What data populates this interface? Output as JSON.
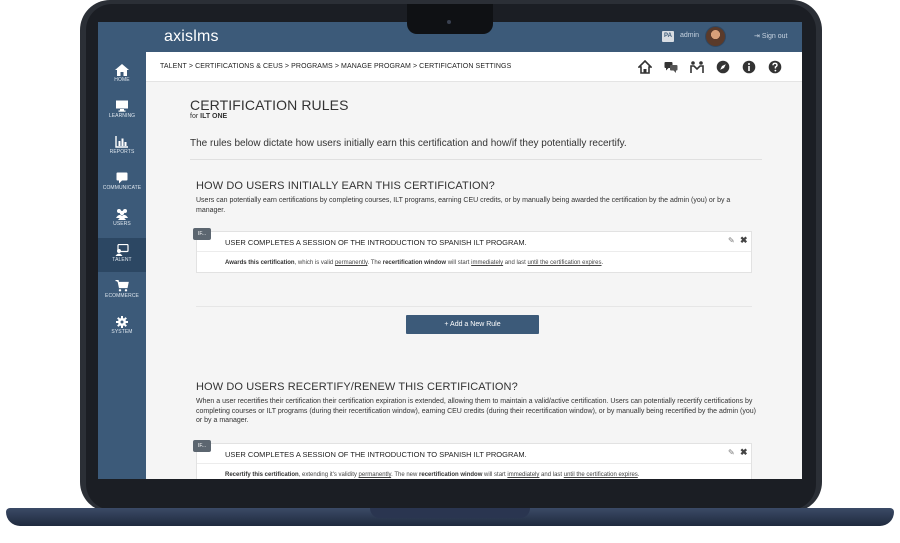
{
  "app": {
    "logo": "axislms",
    "user_badge": "PA",
    "user_name": "admin",
    "signout": "Sign out"
  },
  "breadcrumb": "TALENT  >  CERTIFICATIONS & CEUS  >  PROGRAMS  >  MANAGE PROGRAM  > CERTIFICATION SETTINGS",
  "sidebar": {
    "items": [
      {
        "label": "HOME",
        "icon": "home-icon"
      },
      {
        "label": "LEARNING",
        "icon": "monitor-icon"
      },
      {
        "label": "REPORTS",
        "icon": "chart-icon"
      },
      {
        "label": "COMMUNICATE",
        "icon": "chat-icon"
      },
      {
        "label": "USERS",
        "icon": "users-icon"
      },
      {
        "label": "TALENT",
        "icon": "talent-icon"
      },
      {
        "label": "ECOMMERCE",
        "icon": "cart-icon"
      },
      {
        "label": "SYSTEM",
        "icon": "gear-icon"
      }
    ]
  },
  "page": {
    "title": "CERTIFICATION RULES",
    "sub_prefix": "for",
    "sub_name": "ILT ONE",
    "intro": "The rules below dictate how users initially earn this certification and how/if they potentially recertify."
  },
  "earn": {
    "title": "HOW DO USERS INITIALLY EARN THIS CERTIFICATION?",
    "desc": "Users can potentially earn certifications by completing courses, ILT programs, earning CEU credits, or by manually being awarded the certification by the admin (you) or by a manager.",
    "rule": {
      "badge": "IF...",
      "head": "USER COMPLETES A SESSION OF THE INTRODUCTION TO SPANISH ILT PROGRAM.",
      "b1": "Awards this certification",
      "b2": ", which is valid ",
      "b3": "permanently",
      "b4": ". The ",
      "b5": "recertification window",
      "b6": " will start ",
      "b7": "immediately",
      "b8": " and last ",
      "b9": "until the certification expires",
      "b10": "."
    },
    "add_button": "+ Add a New Rule"
  },
  "recertify": {
    "title": "HOW DO USERS RECERTIFY/RENEW THIS CERTIFICATION?",
    "desc": "When a user recertifies their certification their certification expiration is extended, allowing them to maintain a valid/active certification. Users can potentially recertify certifications by completing courses or ILT programs (during their recertification window), earning CEU credits (during their recertification window), or by manually being recertified by the admin (you) or by a manager.",
    "rule": {
      "badge": "IF...",
      "head": "USER COMPLETES A SESSION OF THE INTRODUCTION TO SPANISH ILT PROGRAM.",
      "b1": "Recertify this certification",
      "b2": ", extending it's validity ",
      "b3": "permanently",
      "b4": ". The new ",
      "b5": "recertification window",
      "b6": " will start ",
      "b7": "immediately",
      "b8": " and last ",
      "b9": "until the certification expires",
      "b10": "."
    }
  },
  "colors": {
    "brand": "#3c5a79",
    "sidebar_active": "#2c4763",
    "background": "#f5f5f5"
  }
}
